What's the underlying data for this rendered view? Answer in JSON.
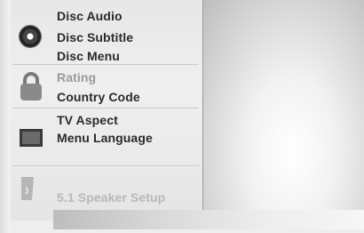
{
  "menu": {
    "items": [
      {
        "label": "Disc Audio"
      },
      {
        "label": "Disc Subtitle"
      },
      {
        "label": "Disc Menu"
      },
      {
        "label": "Rating"
      },
      {
        "label": "Country Code"
      },
      {
        "label": "TV Aspect"
      },
      {
        "label": "Menu Language"
      },
      {
        "label": "5.1 Speaker Setup"
      }
    ]
  },
  "icons": {
    "disc": "disc-icon",
    "lock": "lock-icon",
    "tv": "tv-screen-icon",
    "speaker": "speaker-icon"
  }
}
